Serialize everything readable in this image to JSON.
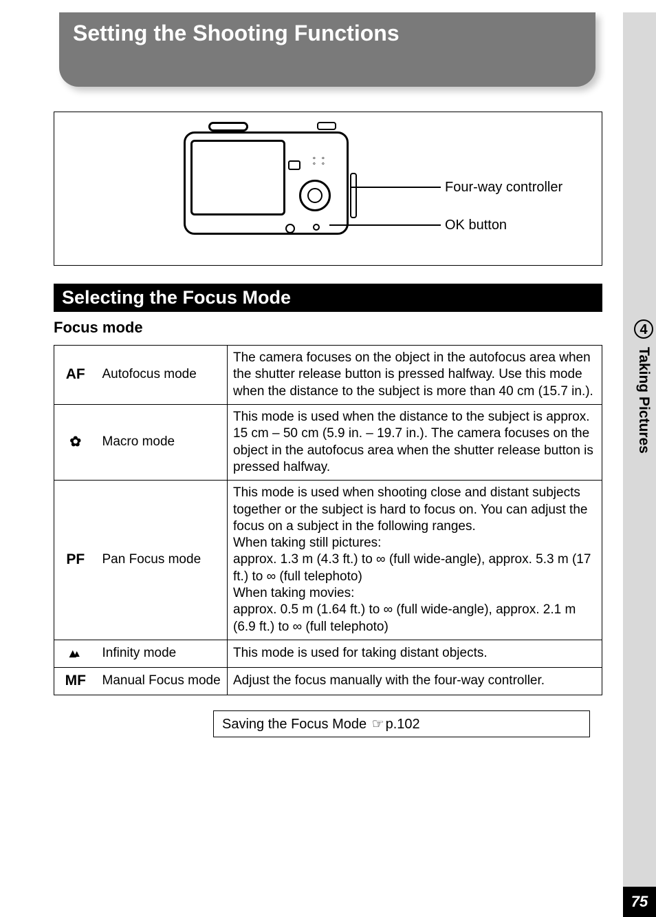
{
  "page": {
    "title": "Setting the Shooting Functions",
    "number": "75"
  },
  "side_tab": {
    "chapter_number": "4",
    "chapter_title": "Taking Pictures"
  },
  "diagram": {
    "callout_controller": "Four-way controller",
    "callout_ok": "OK button"
  },
  "section": {
    "heading": "Selecting the Focus Mode",
    "subheading": "Focus mode"
  },
  "modes": [
    {
      "symbol": "AF",
      "name": "Autofocus mode",
      "description": "The camera focuses on the object in the autofocus area when the shutter release button is pressed halfway. Use this mode when the distance to the subject is more than 40 cm (15.7 in.)."
    },
    {
      "symbol_icon": "flower",
      "name": "Macro mode",
      "description": "This mode is used when the distance to the subject is approx. 15 cm – 50 cm (5.9 in. – 19.7 in.). The camera focuses on the object in the autofocus area when the shutter release button is pressed halfway."
    },
    {
      "symbol": "PF",
      "name": "Pan Focus mode",
      "description": "This mode is used when shooting close and distant subjects together or the subject is hard to focus on. You can adjust the focus on a subject in the following ranges.\nWhen taking still pictures:\napprox. 1.3 m (4.3 ft.) to ∞ (full wide-angle), approx. 5.3 m (17 ft.) to ∞ (full telephoto)\nWhen taking movies:\napprox. 0.5 m (1.64 ft.) to ∞ (full wide-angle), approx. 2.1 m (6.9 ft.) to ∞ (full telephoto)"
    },
    {
      "symbol_icon": "mountain",
      "name": "Infinity mode",
      "description": "This mode is used for taking distant objects."
    },
    {
      "symbol": "MF",
      "name": "Manual Focus mode",
      "description": "Adjust the focus manually with the four-way controller."
    }
  ],
  "reference": {
    "text": "Saving the Focus Mode",
    "page_ref": "p.102"
  }
}
